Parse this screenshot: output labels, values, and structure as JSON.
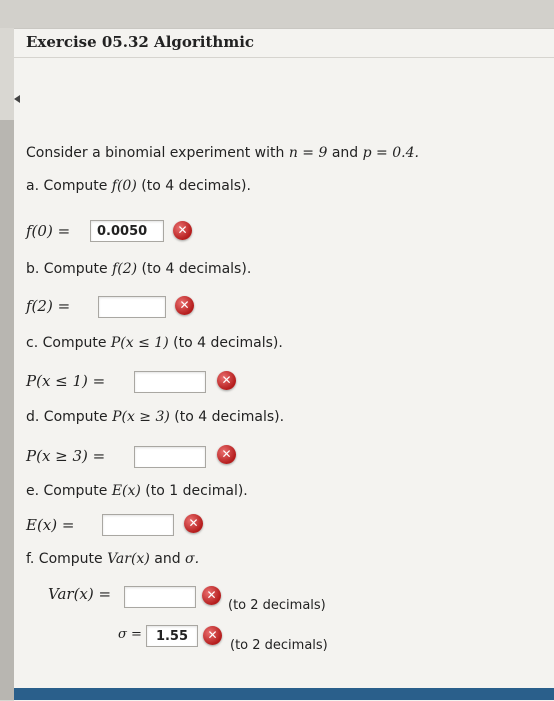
{
  "header": {
    "title": "Exercise 05.32 Algorithmic"
  },
  "problem": {
    "intro_prefix": "Consider a binomial experiment with ",
    "n_expr": "n = 9",
    "mid": " and ",
    "p_expr": "p = 0.4."
  },
  "parts": {
    "a": {
      "prompt_prefix": "a. Compute ",
      "prompt_math": "f(0)",
      "prompt_suffix": " (to 4 decimals).",
      "label": "f(0) =",
      "value": "0.0050"
    },
    "b": {
      "prompt_prefix": "b. Compute ",
      "prompt_math": "f(2)",
      "prompt_suffix": " (to 4 decimals).",
      "label": "f(2) =",
      "value": ""
    },
    "c": {
      "prompt_prefix": "c. Compute ",
      "prompt_math": "P(x ≤ 1)",
      "prompt_suffix": " (to 4 decimals).",
      "label": "P(x ≤ 1) =",
      "value": ""
    },
    "d": {
      "prompt_prefix": "d. Compute ",
      "prompt_math": "P(x ≥ 3)",
      "prompt_suffix": " (to 4 decimals).",
      "label": "P(x ≥ 3) =",
      "value": ""
    },
    "e": {
      "prompt_prefix": "e. Compute ",
      "prompt_math": "E(x)",
      "prompt_suffix": " (to 1 decimal).",
      "label": "E(x) =",
      "value": ""
    },
    "f": {
      "prompt_prefix": "f. Compute ",
      "prompt_math": "Var(x)",
      "prompt_mid": " and ",
      "prompt_sigma": "σ.",
      "var_label": "Var(x) =",
      "var_value": "",
      "var_note": "(to 2 decimals)",
      "sigma_label": "σ =",
      "sigma_value": "1.55",
      "sigma_note": "(to 2 decimals)"
    }
  },
  "feedback": {
    "incorrect_symbol": "✕"
  }
}
